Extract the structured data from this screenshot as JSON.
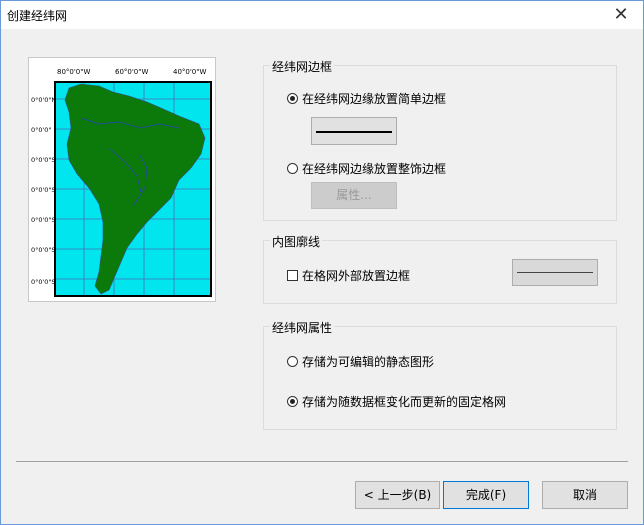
{
  "window": {
    "title": "创建经纬网",
    "close_glyph": "✕"
  },
  "preview": {
    "top_labels": [
      "80°0'0\"W",
      "60°0'0\"W",
      "40°0'0\"W"
    ],
    "left_labels": [
      "0°0'0\"N",
      "0°0'0\"",
      "0°0'0\"S",
      "0°0'0\"S",
      "0°0'0\"S",
      "0°0'0\"S",
      "0°0'0\"S"
    ],
    "colors": {
      "ocean": "#00e5ee",
      "land": "#0b7a0b",
      "grid": "#4a6fb5",
      "frame": "#000000"
    }
  },
  "graticule_border": {
    "label": "经纬网边框",
    "option_simple": "在经纬网边缘放置简单边框",
    "option_fancy": "在经纬网边缘放置整饰边框",
    "properties_button": "属性..."
  },
  "inner_neatline": {
    "label": "内图廓线",
    "checkbox_label": "在格网外部放置边框"
  },
  "graticule_props": {
    "label": "经纬网属性",
    "option_static": "存储为可编辑的静态图形",
    "option_fixed": "存储为随数据框变化而更新的固定格网"
  },
  "footer": {
    "back_button": "< 上一步(B)",
    "finish_button": "完成(F)",
    "cancel_button": "取消"
  }
}
